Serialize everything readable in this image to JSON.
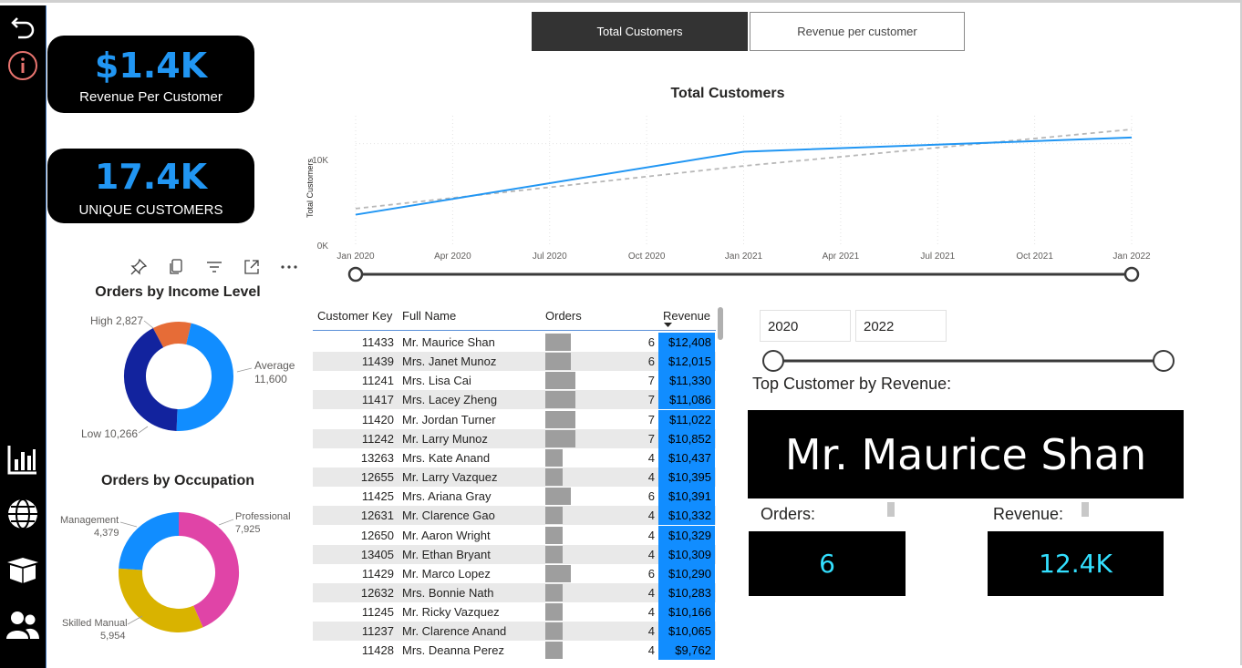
{
  "nav": {
    "icons": [
      "back-arrow-icon",
      "info-icon",
      "bar-chart-icon",
      "globe-icon",
      "box-icon",
      "users-icon"
    ]
  },
  "kpis": {
    "revenue_per_customer": {
      "value": "$1.4K",
      "label": "Revenue Per Customer"
    },
    "unique_customers": {
      "value": "17.4K",
      "label": "UNIQUE CUSTOMERS"
    }
  },
  "toggle": {
    "total_customers": "Total Customers",
    "revenue_per_customer": "Revenue per customer"
  },
  "line_chart": {
    "title": "Total Customers",
    "ylabel": "Total Customers",
    "y_ticks": [
      "10K",
      "0K"
    ],
    "x_ticks": [
      "Jan 2020",
      "Apr 2020",
      "Jul 2020",
      "Oct 2020",
      "Jan 2021",
      "Apr 2021",
      "Jul 2021",
      "Oct 2021",
      "Jan 2022"
    ]
  },
  "visual_toolbar": [
    "pin-icon",
    "copy-icon",
    "filter-icon",
    "focus-mode-icon",
    "more-options-icon"
  ],
  "income_donut": {
    "title": "Orders by Income Level",
    "labels": {
      "high": "High 2,827",
      "average_name": "Average",
      "average_value": "11,600",
      "low": "Low 10,266"
    }
  },
  "occupation_donut": {
    "title": "Orders by Occupation",
    "labels": {
      "management_name": "Management",
      "management_value": "4,379",
      "professional_name": "Professional",
      "professional_value": "7,925",
      "skilled_name": "Skilled Manual",
      "skilled_value": "5,954"
    }
  },
  "table": {
    "headers": {
      "key": "Customer Key",
      "name": "Full Name",
      "orders": "Orders",
      "revenue": "Revenue"
    },
    "rows": [
      {
        "key": "11433",
        "name": "Mr. Maurice Shan",
        "orders": "6",
        "revenue": "$12,408"
      },
      {
        "key": "11439",
        "name": "Mrs. Janet Munoz",
        "orders": "6",
        "revenue": "$12,015"
      },
      {
        "key": "11241",
        "name": "Mrs. Lisa Cai",
        "orders": "7",
        "revenue": "$11,330"
      },
      {
        "key": "11417",
        "name": "Mrs. Lacey Zheng",
        "orders": "7",
        "revenue": "$11,086"
      },
      {
        "key": "11420",
        "name": "Mr. Jordan Turner",
        "orders": "7",
        "revenue": "$11,022"
      },
      {
        "key": "11242",
        "name": "Mr. Larry Munoz",
        "orders": "7",
        "revenue": "$10,852"
      },
      {
        "key": "13263",
        "name": "Mrs. Kate Anand",
        "orders": "4",
        "revenue": "$10,437"
      },
      {
        "key": "12655",
        "name": "Mr. Larry Vazquez",
        "orders": "4",
        "revenue": "$10,395"
      },
      {
        "key": "11425",
        "name": "Mrs. Ariana Gray",
        "orders": "6",
        "revenue": "$10,391"
      },
      {
        "key": "12631",
        "name": "Mr. Clarence Gao",
        "orders": "4",
        "revenue": "$10,332"
      },
      {
        "key": "12650",
        "name": "Mr. Aaron Wright",
        "orders": "4",
        "revenue": "$10,329"
      },
      {
        "key": "13405",
        "name": "Mr. Ethan Bryant",
        "orders": "4",
        "revenue": "$10,309"
      },
      {
        "key": "11429",
        "name": "Mr. Marco Lopez",
        "orders": "6",
        "revenue": "$10,290"
      },
      {
        "key": "12632",
        "name": "Mrs. Bonnie Nath",
        "orders": "4",
        "revenue": "$10,283"
      },
      {
        "key": "11245",
        "name": "Mr. Ricky Vazquez",
        "orders": "4",
        "revenue": "$10,166"
      },
      {
        "key": "11237",
        "name": "Mr. Clarence Anand",
        "orders": "4",
        "revenue": "$10,065"
      },
      {
        "key": "11428",
        "name": "Mrs. Deanna Perez",
        "orders": "4",
        "revenue": "$9,762"
      }
    ]
  },
  "date_slicer": {
    "start": "2020",
    "end": "2022"
  },
  "top_customer": {
    "heading": "Top Customer by Revenue:",
    "name": "Mr. Maurice Shan",
    "orders_label": "Orders:",
    "orders_value": "6",
    "revenue_label": "Revenue:",
    "revenue_value": "12.4K"
  },
  "colors": {
    "accent_blue": "#2196f3",
    "teal_value": "#33e0ff",
    "revenue_cell": "#118dff"
  },
  "chart_data": [
    {
      "type": "line",
      "title": "Total Customers",
      "xlabel": "",
      "ylabel": "Total Customers",
      "x": [
        "Jan 2020",
        "Jan 2021",
        "Jan 2022"
      ],
      "series": [
        {
          "values": [
            3000,
            9200,
            10600
          ]
        }
      ],
      "trend": [
        3600,
        7800,
        11400
      ],
      "ylim": [
        0,
        14000
      ],
      "grid": true
    },
    {
      "type": "pie",
      "title": "Orders by Income Level",
      "categories": [
        "High",
        "Average",
        "Low"
      ],
      "values": [
        2827,
        11600,
        10266
      ],
      "colors": [
        "#e66c37",
        "#118dff",
        "#12239e"
      ]
    },
    {
      "type": "pie",
      "title": "Orders by Occupation",
      "categories": [
        "Professional",
        "Skilled Manual",
        "Management"
      ],
      "values": [
        7925,
        5954,
        4379
      ],
      "colors": [
        "#e044a7",
        "#d9b300",
        "#118dff"
      ]
    }
  ]
}
